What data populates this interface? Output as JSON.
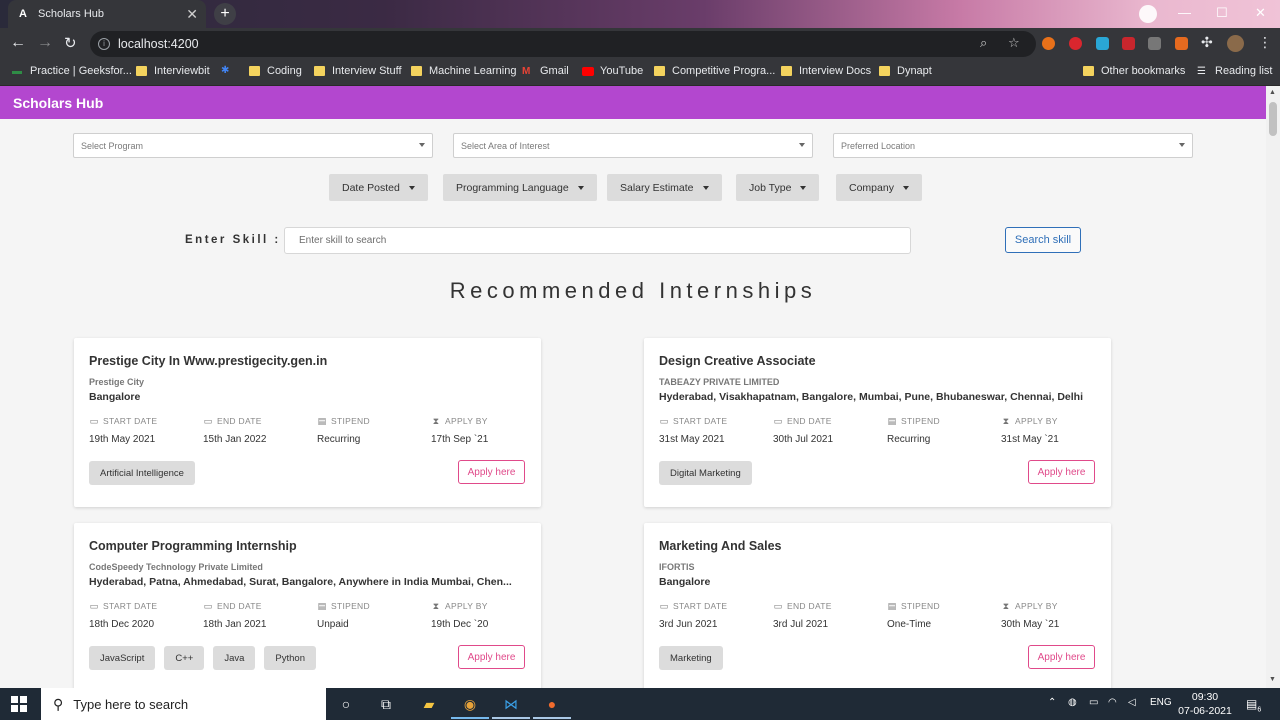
{
  "browser": {
    "tab_title": "Scholars Hub",
    "tab_favicon": "A",
    "url": "localhost:4200",
    "bookmarks": [
      {
        "label": "Practice | Geeksfor...",
        "icon": "gfg-icon"
      },
      {
        "label": "Interviewbit",
        "icon": "folder-icon"
      },
      {
        "label": "",
        "icon": "pinwheel-icon"
      },
      {
        "label": "Coding",
        "icon": "folder-icon"
      },
      {
        "label": "Interview Stuff",
        "icon": "folder-icon"
      },
      {
        "label": "Machine Learning",
        "icon": "folder-icon"
      },
      {
        "label": "Gmail",
        "icon": "gmail-icon"
      },
      {
        "label": "YouTube",
        "icon": "youtube-icon"
      },
      {
        "label": "Competitive Progra...",
        "icon": "folder-icon"
      },
      {
        "label": "Interview Docs",
        "icon": "folder-icon"
      },
      {
        "label": "Dynapt",
        "icon": "folder-icon"
      },
      {
        "label": "Other bookmarks",
        "icon": "folder-icon"
      },
      {
        "label": "Reading list",
        "icon": "reading-list-icon"
      }
    ]
  },
  "app": {
    "brand": "Scholars Hub",
    "selects": [
      {
        "placeholder": "Select Program"
      },
      {
        "placeholder": "Select Area of Interest"
      },
      {
        "placeholder": "Preferred Location"
      }
    ],
    "filters": [
      "Date Posted",
      "Programming Language",
      "Salary Estimate",
      "Job Type",
      "Company"
    ],
    "skill_label": "Enter Skill :",
    "skill_placeholder": "Enter skill to search",
    "skill_button": "Search skill",
    "heading": "Recommended Internships",
    "labels": {
      "start": "START DATE",
      "end": "END DATE",
      "stipend": "STIPEND",
      "apply_by": "APPLY BY",
      "apply": "Apply here"
    },
    "cards": [
      {
        "title": "Prestige City In Www.prestigecity.gen.in",
        "company": "Prestige City",
        "location": "Bangalore",
        "start": "19th May 2021",
        "end": "15th Jan 2022",
        "stipend": "Recurring",
        "apply_by": "17th Sep `21",
        "tags": [
          "Artificial Intelligence"
        ]
      },
      {
        "title": "Design Creative Associate",
        "company": "TABEAZY PRIVATE LIMITED",
        "location": "Hyderabad, Visakhapatnam, Bangalore, Mumbai, Pune, Bhubaneswar, Chennai, Delhi",
        "start": "31st May 2021",
        "end": "30th Jul 2021",
        "stipend": "Recurring",
        "apply_by": "31st May `21",
        "tags": [
          "Digital Marketing"
        ]
      },
      {
        "title": "Computer Programming Internship",
        "company": "CodeSpeedy Technology Private Limited",
        "location": "Hyderabad, Patna, Ahmedabad, Surat, Bangalore, Anywhere in India Mumbai, Chen...",
        "start": "18th Dec 2020",
        "end": "18th Jan 2021",
        "stipend": "Unpaid",
        "apply_by": "19th Dec `20",
        "tags": [
          "JavaScript",
          "C++",
          "Java",
          "Python"
        ]
      },
      {
        "title": "Marketing And Sales",
        "company": "IFORTIS",
        "location": "Bangalore",
        "start": "3rd Jun 2021",
        "end": "3rd Jul 2021",
        "stipend": "One-Time",
        "apply_by": "30th May `21",
        "tags": [
          "Marketing"
        ]
      }
    ]
  },
  "taskbar": {
    "search_placeholder": "Type here to search",
    "language": "ENG",
    "time": "09:30",
    "date": "07-06-2021",
    "notification_count": "6"
  },
  "colors": {
    "appbar": "#b347cf",
    "apply_button": "#e04a8a",
    "search_button": "#2f6fb8"
  }
}
